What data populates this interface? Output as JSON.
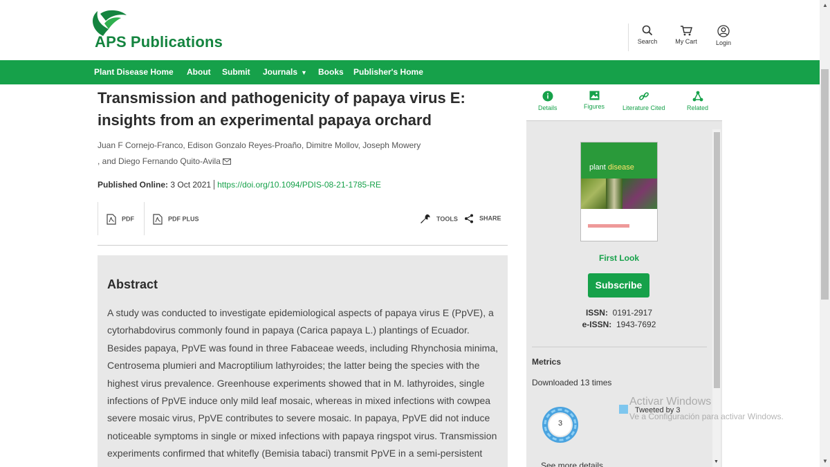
{
  "header": {
    "logo_aps": "APS",
    "logo_publications": "Publications",
    "actions": [
      {
        "label": "Search",
        "icon": "search-icon"
      },
      {
        "label": "My Cart",
        "icon": "cart-icon"
      },
      {
        "label": "Login",
        "icon": "user-icon"
      }
    ]
  },
  "nav": {
    "items": [
      "Plant Disease Home",
      "About",
      "Submit",
      "Journals",
      "Books",
      "Publisher's Home"
    ]
  },
  "article": {
    "title": "Transmission and pathogenicity of papaya virus E: insights from an experimental papaya orchard",
    "authors_line1": "Juan F Cornejo-Franco, Edison Gonzalo Reyes-Proaño, Dimitre Mollov, Joseph Mowery",
    "authors_line2": ", and Diego Fernando Quito-Avila",
    "published_label": "Published Online:",
    "published_date": "3 Oct 2021",
    "doi": "https://doi.org/10.1094/PDIS-08-21-1785-RE",
    "tools": {
      "pdf": "PDF",
      "pdf_plus": "PDF PLUS",
      "tools": "TOOLS",
      "share": "SHARE"
    },
    "abstract_heading": "Abstract",
    "abstract_text": "A study was conducted to investigate epidemiological aspects of papaya virus E (PpVE), a cytorhabdovirus commonly found in papaya (Carica papaya L.) plantings of Ecuador. Besides papaya, PpVE was found in three Fabaceae weeds, including Rhynchosia minima, Centrosema plumieri and Macroptilium lathyroides; the latter being the species with the highest virus prevalence. Greenhouse experiments showed that in M. lathyroides, single infections of PpVE induce only mild leaf mosaic, whereas in mixed infections with cowpea severe mosaic virus, PpVE contributes to severe mosaic. In papaya, PpVE did not induce noticeable symptoms in single or mixed infections with papaya ringspot virus. Transmission experiments confirmed that whitefly (Bemisia tabaci) transmit PpVE in a semi-persistent manner to papaya"
  },
  "sidebar": {
    "tabs": [
      "Details",
      "Figures",
      "Literature Cited",
      "Related"
    ],
    "cover_title_a": "plant",
    "cover_title_b": "disease",
    "first_look": "First Look",
    "subscribe": "Subscribe",
    "issn_label": "ISSN:",
    "issn": "0191-2917",
    "eissn_label": "e-ISSN:",
    "eissn": "1943-7692",
    "metrics_heading": "Metrics",
    "downloaded": "Downloaded 13 times",
    "altmetric_score": "3",
    "tweeted": "Tweeted by 3",
    "see_more": "See more details"
  },
  "watermark": {
    "line1": "Activar Windows",
    "line2": "Ve a Configuración para activar Windows."
  },
  "colors": {
    "brand_green": "#16a14a",
    "panel_gray": "#e8e8e8"
  }
}
